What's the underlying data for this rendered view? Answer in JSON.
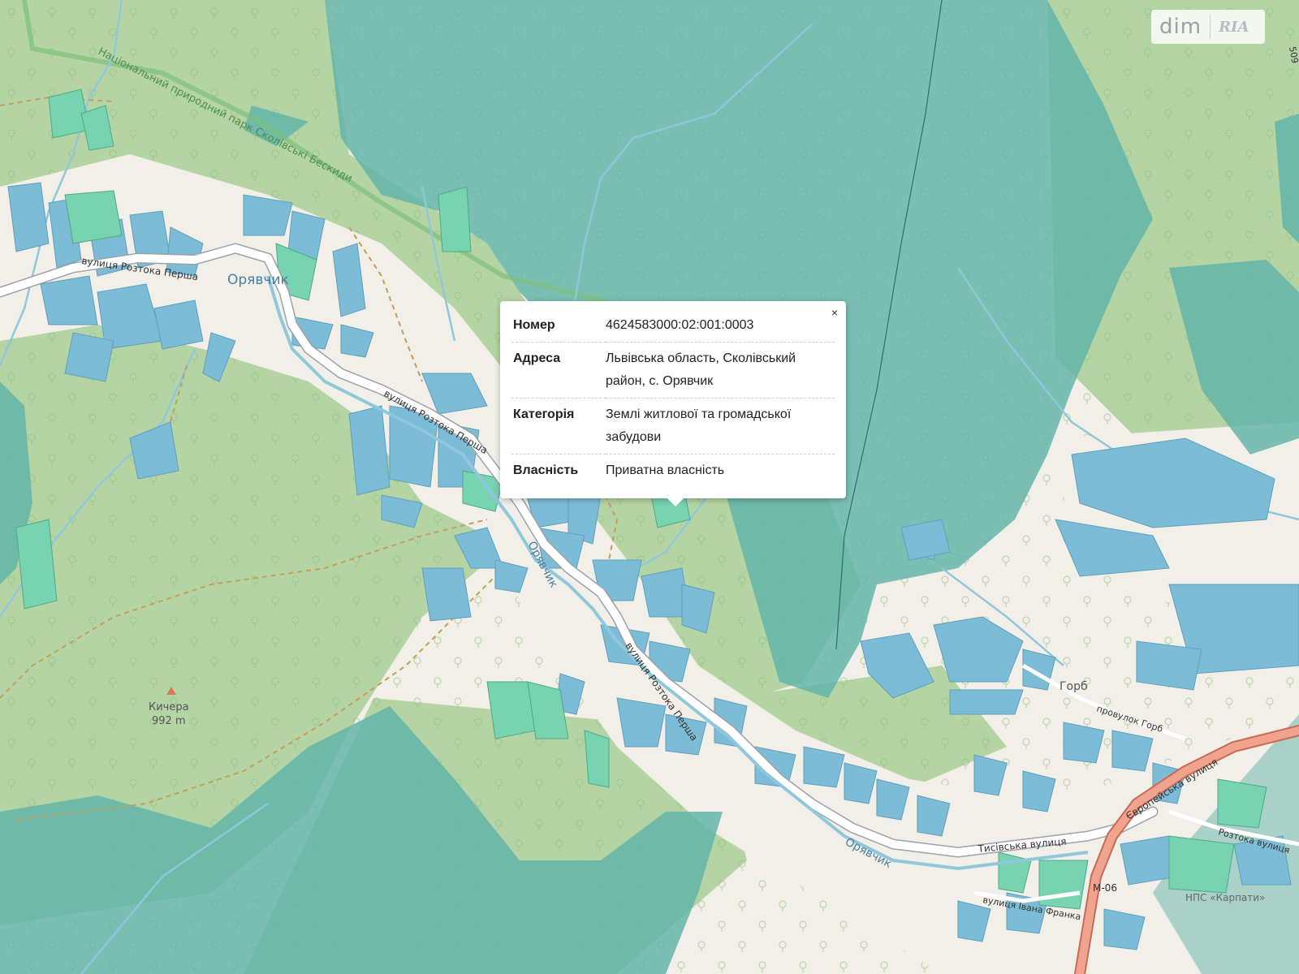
{
  "map": {
    "labels": {
      "park": "Національний природний парк Сколівські Бескиди",
      "village": "Орявчик",
      "street_1": "вулиця Розтока Перша",
      "street_2": "вулиця Розтока Перша",
      "street_3": "вулиця Розтока Перша",
      "river_1": "Орявчик",
      "river_2": "Орявчик",
      "peak_name": "Кичера",
      "peak_height": "992 m",
      "hamlet": "Горб",
      "lane": "провулок Горб",
      "euro_street": "Європейська вулиця",
      "tysiv_street": "Тисівська вулиця",
      "franko_street": "вулиця Івана Франка",
      "road_code": "М-06",
      "nps": "НПС «Карпати»",
      "rostochka": "Розтока вулиця",
      "edge_text": "509"
    },
    "colors": {
      "background": "#f2efe9",
      "forest": "#add19e",
      "cadastre_teal": "#5fb3a8",
      "parcel_blue": "#7cbcd6",
      "parcel_green": "#77d3b0",
      "road_main": "#e8927c",
      "water": "#aad3df"
    }
  },
  "watermark": {
    "brand": "dim",
    "sub_brand": "RIA"
  },
  "popup": {
    "close_icon": "×",
    "rows": [
      {
        "label": "Номер",
        "value": "4624583000:02:001:0003"
      },
      {
        "label": "Адреса",
        "value": "Львівська область, Сколівський район, с. Орявчик"
      },
      {
        "label": "Категорія",
        "value": "Землі житлової та громадської забудови"
      },
      {
        "label": "Власність",
        "value": "Приватна власність"
      }
    ]
  }
}
